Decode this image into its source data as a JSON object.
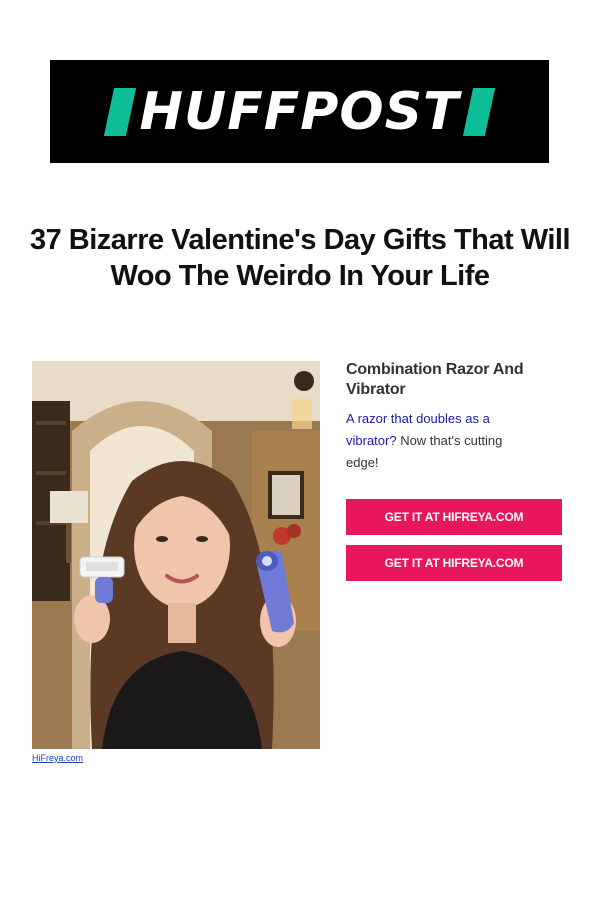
{
  "brand": {
    "name": "HUFFPOST",
    "bar_color": "#0dbe98",
    "banner_color": "#000000"
  },
  "article": {
    "headline_line1": "37 Bizarre Valentine's Day Gifts That Will",
    "headline_line2": "Woo The Weirdo In Your Life"
  },
  "product": {
    "title_line1": "Combination Razor And",
    "title_line2": "Vibrator",
    "desc_link": "A razor that doubles as a vibrator?",
    "desc_text": " Now that's cutting edge!",
    "image_credit": "HiFreya.com",
    "buttons": [
      {
        "label": "GET IT AT HIFREYA.COM"
      },
      {
        "label": "GET IT AT HIFREYA.COM"
      }
    ],
    "button_color": "#e8175d"
  }
}
